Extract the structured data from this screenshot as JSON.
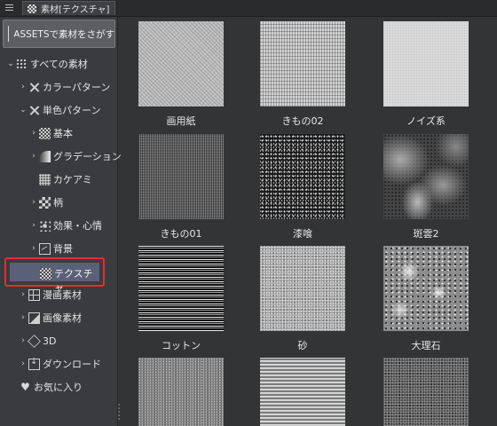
{
  "window": {
    "tab_title": "素材[テクスチャ]"
  },
  "sidebar": {
    "assets_button_label": "ASSETSで素材をさがす",
    "tree": [
      {
        "label": "すべての素材",
        "icon": "dots-grid-icon",
        "expanded": true
      },
      {
        "label": "カラーパターン",
        "icon": "cross-icon",
        "expanded": false
      },
      {
        "label": "単色パターン",
        "icon": "cross-icon",
        "expanded": true
      },
      {
        "label": "基本",
        "icon": "checker-icon",
        "expanded": false
      },
      {
        "label": "グラデーション",
        "icon": "gradient-icon",
        "expanded": false
      },
      {
        "label": "カケアミ",
        "icon": "halftone-icon"
      },
      {
        "label": "柄",
        "icon": "pattern-icon",
        "expanded": false
      },
      {
        "label": "効果・心情",
        "icon": "effect-icon",
        "expanded": false
      },
      {
        "label": "背景",
        "icon": "background-icon",
        "expanded": false
      },
      {
        "label": "テクスチャ",
        "icon": "texture-icon",
        "selected": true
      },
      {
        "label": "漫画素材",
        "icon": "manga-icon",
        "expanded": false
      },
      {
        "label": "画像素材",
        "icon": "image-icon",
        "expanded": false
      },
      {
        "label": "3D",
        "icon": "cube-icon",
        "expanded": false
      },
      {
        "label": "ダウンロード",
        "icon": "download-icon",
        "expanded": false
      },
      {
        "label": "お気に入り",
        "icon": "heart-icon"
      }
    ]
  },
  "materials": [
    {
      "name": "画用紙"
    },
    {
      "name": "きもの02"
    },
    {
      "name": "ノイズ系"
    },
    {
      "name": "きもの01"
    },
    {
      "name": "漆喰"
    },
    {
      "name": "斑雲2"
    },
    {
      "name": "コットン"
    },
    {
      "name": "砂"
    },
    {
      "name": "大理石"
    },
    {
      "name": ""
    },
    {
      "name": ""
    },
    {
      "name": ""
    }
  ]
}
